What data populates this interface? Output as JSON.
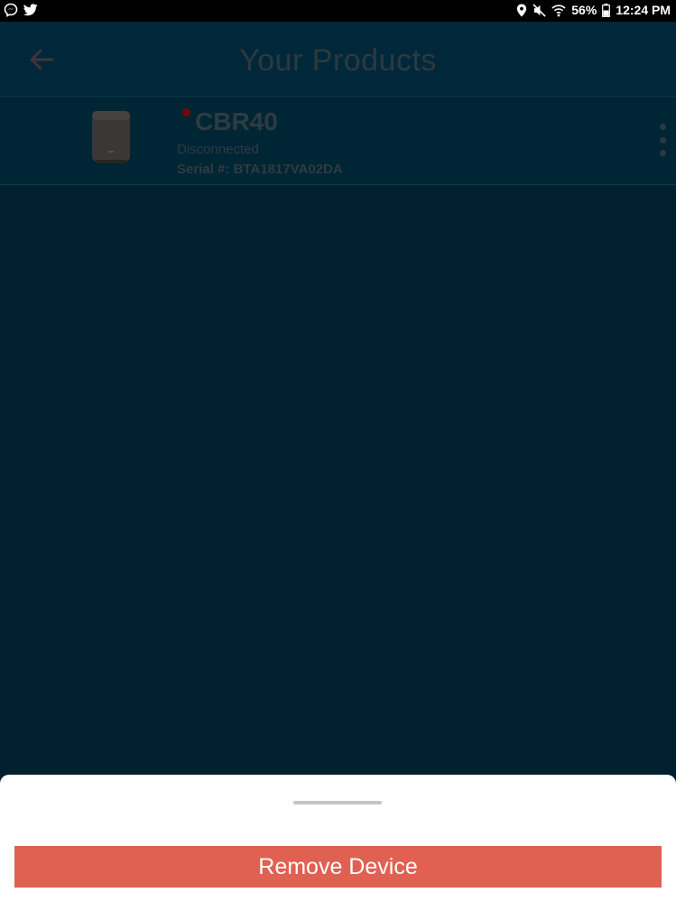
{
  "status_bar": {
    "battery_percent": "56%",
    "time": "12:24 PM",
    "icons": [
      "messenger-icon",
      "twitter-icon",
      "location-icon",
      "mute-icon",
      "wifi-icon",
      "battery-icon"
    ]
  },
  "header": {
    "title": "Your Products",
    "back_icon": "arrow-left-icon"
  },
  "products": [
    {
      "name": "CBR40",
      "status": "Disconnected",
      "serial": "Serial #: BTA1817VA02DA",
      "status_color": "#6e0a0a",
      "menu_icon": "more-vertical-icon"
    }
  ],
  "sheet": {
    "action_label": "Remove Device",
    "action_color": "#e06052"
  }
}
